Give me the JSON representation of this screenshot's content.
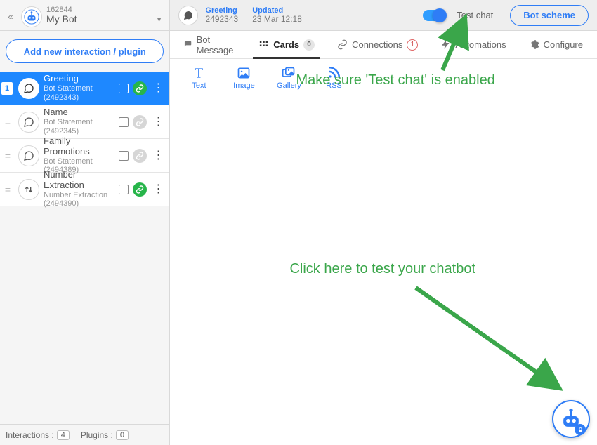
{
  "bot": {
    "id": "162844",
    "name": "My Bot"
  },
  "sidebar": {
    "add_button": "Add new interaction / plugin",
    "items": [
      {
        "badge": "1",
        "title": "Greeting",
        "subtitle": "Bot Statement (2492343)",
        "linked": true,
        "selected": true,
        "icon": "speech"
      },
      {
        "badge": "",
        "title": "Name",
        "subtitle": "Bot Statement (2492345)",
        "linked": false,
        "selected": false,
        "icon": "speech"
      },
      {
        "badge": "",
        "title": "Family Promotions",
        "subtitle": "Bot Statement (2494389)",
        "linked": false,
        "selected": false,
        "icon": "speech"
      },
      {
        "badge": "",
        "title": "Number Extraction",
        "subtitle": "Number Extraction (2494390)",
        "linked": true,
        "selected": false,
        "icon": "updown"
      }
    ],
    "footer": {
      "interactions_label": "Interactions :",
      "interactions_count": "4",
      "plugins_label": "Plugins :",
      "plugins_count": "0"
    }
  },
  "header": {
    "crumb1_label": "Greeting",
    "crumb1_value": "2492343",
    "crumb2_label": "Updated",
    "crumb2_value": "23 Mar 12:18",
    "testchat_label": "Test chat",
    "scheme_button": "Bot scheme"
  },
  "tabs": {
    "botmessage": "Bot Message",
    "cards": "Cards",
    "cards_count": "0",
    "connections": "Connections",
    "connections_count": "1",
    "automations": "Automations",
    "configure": "Configure"
  },
  "tools": {
    "text": "Text",
    "image": "Image",
    "gallery": "Gallery",
    "rss": "RSS"
  },
  "annotations": {
    "note1": "Make sure 'Test chat' is enabled",
    "note2": "Click here to test your chatbot"
  }
}
